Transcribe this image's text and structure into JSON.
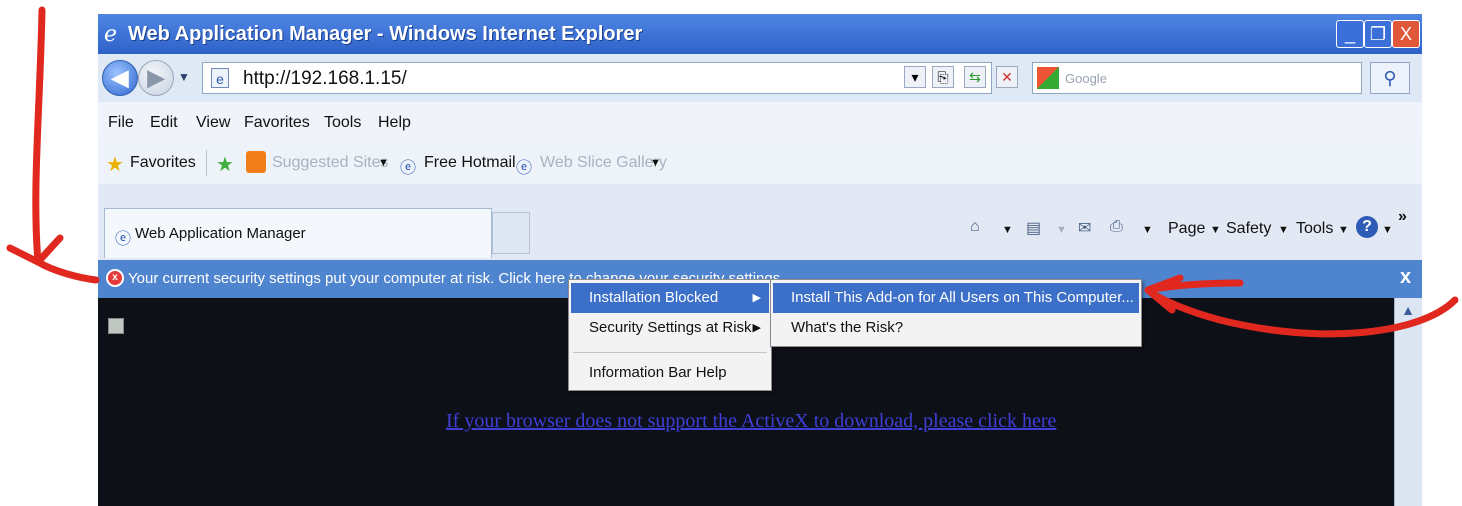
{
  "window": {
    "title": "Web Application Manager - Windows Internet Explorer",
    "minimize": "_",
    "maximize": "❐",
    "close": "X"
  },
  "address": {
    "url": "http://192.168.1.15/",
    "search_placeholder": "Google"
  },
  "menu": [
    "File",
    "Edit",
    "View",
    "Favorites",
    "Tools",
    "Help"
  ],
  "favorites_bar": {
    "favorites_label": "Favorites",
    "suggested_sites": "Suggested Sites",
    "free_hotmail": "Free Hotmail",
    "web_slice_gallery": "Web Slice Gallery"
  },
  "tab": {
    "title": "Web Application Manager"
  },
  "command_bar": {
    "page": "Page",
    "safety": "Safety",
    "tools": "Tools",
    "chevron": "»"
  },
  "info_bar": {
    "text": "Your current security settings put your computer at risk. Click here to change your security settings...",
    "close": "x"
  },
  "context_menu": {
    "items": [
      "Installation Blocked",
      "Security Settings at Risk",
      "Information Bar Help"
    ]
  },
  "submenu": {
    "items": [
      "Install This Add-on for All Users on This Computer...",
      "What's the Risk?"
    ]
  },
  "content": {
    "link": "If your browser does not support the ActiveX to download, please click here"
  },
  "colors": {
    "annotation_arrow": "#e0281e",
    "title_bar": "#3a6fd4",
    "info_bar": "#4f84cf",
    "menu_highlight": "#3b6fc8"
  }
}
